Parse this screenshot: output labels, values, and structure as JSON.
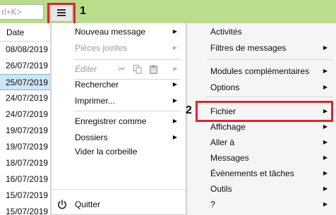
{
  "toolbar": {
    "search_placeholder": "rl+K>",
    "menu_button_icon": "hamburger-icon",
    "callout_1": "1",
    "callout_2": "2",
    "highlight_color": "#e0242b",
    "toolbar_color": "#b9dd8a"
  },
  "message_list": {
    "header": "Date",
    "rows": [
      "08/08/2019",
      "26/07/2019",
      "25/07/2019",
      "24/07/2019",
      "24/07/2019",
      "19/07/2019",
      "19/07/2019",
      "18/07/2019",
      "16/07/2019",
      "15/07/2019",
      "15/07/2019"
    ],
    "selected_row": "25/07/2019"
  },
  "main_menu": {
    "items": [
      {
        "label": "Nouveau message",
        "has_submenu": true,
        "enabled": true
      },
      {
        "label": "Pièces jointes",
        "has_submenu": true,
        "enabled": false
      },
      {
        "label": "Éditer",
        "has_submenu": true,
        "enabled": false
      },
      {
        "label": "Rechercher",
        "has_submenu": true,
        "enabled": true
      },
      {
        "label": "Imprimer...",
        "has_submenu": true,
        "enabled": true
      },
      {
        "label": "Enregistrer comme",
        "has_submenu": true,
        "enabled": true
      },
      {
        "label": "Dossiers",
        "has_submenu": true,
        "enabled": true
      },
      {
        "label": "Vider la corbeille",
        "has_submenu": false,
        "enabled": true
      },
      {
        "label": "Quitter",
        "has_submenu": false,
        "enabled": true,
        "icon": "power-icon"
      }
    ],
    "edit_icons": [
      "scissors-icon",
      "copy-icon",
      "paste-icon"
    ]
  },
  "sub_menu": {
    "items": [
      {
        "label": "Activités",
        "has_submenu": false
      },
      {
        "label": "Filtres de messages",
        "has_submenu": true
      },
      {
        "label": "Modules complémentaires",
        "has_submenu": true
      },
      {
        "label": "Options",
        "has_submenu": true
      },
      {
        "label": "Fichier",
        "has_submenu": true,
        "highlighted": true
      },
      {
        "label": "Affichage",
        "has_submenu": true
      },
      {
        "label": "Aller à",
        "has_submenu": true
      },
      {
        "label": "Messages",
        "has_submenu": true
      },
      {
        "label": "Évènements et tâches",
        "has_submenu": true
      },
      {
        "label": "Outils",
        "has_submenu": true
      },
      {
        "label": "?",
        "has_submenu": true
      }
    ]
  }
}
